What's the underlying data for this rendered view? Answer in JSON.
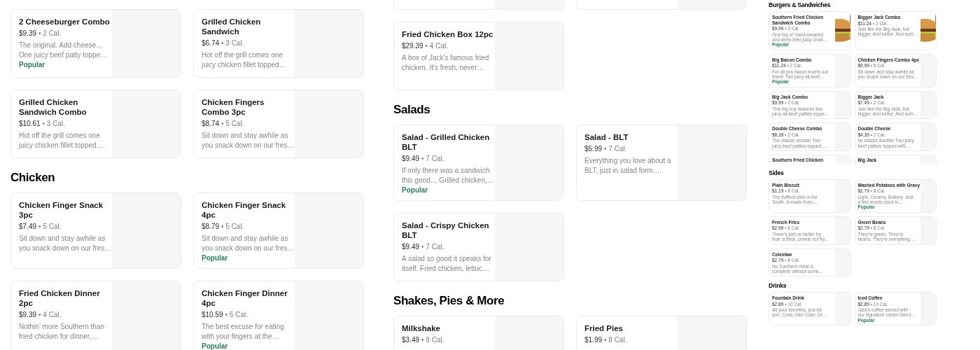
{
  "panels": [
    {
      "sections": [
        {
          "items": [
            {
              "kind": "item",
              "name": "2 Cheeseburger Combo",
              "price": "$9.39",
              "calories": "• 2 Cal.",
              "description": [
                "The original. Add cheese…",
                "One juicy beef patty toppe…"
              ],
              "badge": "Popular"
            },
            {
              "kind": "item",
              "name": "Grilled Chicken Sandwich",
              "price": "$6.74",
              "calories": "• 3 Cal.",
              "description": [
                "Hot off the grill comes one",
                "juicy chicken fillet topped…"
              ]
            },
            {
              "kind": "item",
              "name": "Grilled Chicken Sandwich Combo",
              "price": "$10.61",
              "calories": "• 3 Cal.",
              "description": [
                "Hot off the grill comes one",
                "juicy chicken fillet topped…"
              ]
            },
            {
              "kind": "item",
              "name": "Chicken Fingers Combo 3pc",
              "price": "$8.74",
              "calories": "• 5 Cal.",
              "description": [
                "Sit down and stay awhile as",
                "you snack down on our fres…"
              ]
            }
          ]
        },
        {
          "heading": "Chicken",
          "items": [
            {
              "kind": "item",
              "name": "Chicken Finger Snack 3pc",
              "price": "$7.49",
              "calories": "• 5 Cal.",
              "description": [
                "Sit down and stay awhile as",
                "you snack down on our fres…"
              ]
            },
            {
              "kind": "item",
              "name": "Chicken Finger Snack 4pc",
              "price": "$8.79",
              "calories": "• 5 Cal.",
              "description": [
                "Sit down and stay awhile as",
                "you snack down on our fres…"
              ],
              "badge": "Popular"
            },
            {
              "kind": "item",
              "name": "Fried Chicken Dinner 2pc",
              "price": "$9.39",
              "calories": "• 4 Cal.",
              "description": [
                "Nothin' more Southern than",
                "fried chicken for dinner,…"
              ]
            },
            {
              "kind": "item",
              "name": "Chicken Finger Dinner 4pc",
              "price": "$10.59",
              "calories": "• 5 Cal.",
              "description": [
                "The best excuse for eating",
                "with your fingers at the…"
              ],
              "badge": "Popular"
            }
          ]
        }
      ]
    },
    {
      "sections": [
        {
          "items": [
            {
              "kind": "clipped"
            },
            {
              "kind": "clipped"
            },
            {
              "kind": "item",
              "name": "Fried Chicken Box 12pc",
              "price": "$29.39",
              "calories": "• 4 Cal.",
              "description": [
                "A box of Jack's famous fried",
                "chicken. It's fresh, never…"
              ]
            }
          ]
        },
        {
          "heading": "Salads",
          "items": [
            {
              "kind": "item",
              "name": "Salad - Grilled Chicken BLT",
              "price": "$9.49",
              "calories": "• 7 Cal.",
              "description": [
                "If only there was a sandwich",
                "this good… Grilled chicken,…"
              ],
              "badge": "Popular"
            },
            {
              "kind": "item",
              "name": "Salad - BLT",
              "price": "$5.99",
              "calories": "• 7 Cal.",
              "description": [
                "Everything you love about a",
                "BLT, just in salad form.…"
              ]
            },
            {
              "kind": "item",
              "name": "Salad - Crispy Chicken BLT",
              "price": "$9.49",
              "calories": "• 7 Cal.",
              "description": [
                "A salad so good it speaks for",
                "itself. Fried chicken, lettuc…"
              ]
            }
          ]
        },
        {
          "heading": "Shakes, Pies & More",
          "items": [
            {
              "kind": "item",
              "name": "Milkshake",
              "price": "$3.49",
              "calories": "• 9 Cal."
            },
            {
              "kind": "item",
              "name": "Fried Pies",
              "price": "$1.99",
              "calories": "• 8 Cal."
            }
          ]
        }
      ]
    }
  ],
  "preview": {
    "sections": [
      {
        "heading": "Burgers & Sandwiches",
        "items": [
          {
            "kind": "item",
            "name": "Southern Fried Chicken Sandwich Combo",
            "price": "$9.99",
            "calories": "• 3 Cal.",
            "description": [
              "One big ol' hand-breaded",
              "and deep-fried juicy chick…"
            ],
            "badge": "Popular",
            "image": {
              "kind": "picture"
            }
          },
          {
            "kind": "item",
            "name": "Bigger Jack Combo",
            "price": "$11.24",
            "calories": "• 2 Cal.",
            "description": [
              "Just like the Big Jack, but",
              "bigger. And better. And som…"
            ],
            "image": {
              "kind": "picture"
            }
          },
          {
            "kind": "item",
            "name": "Big Bacon Combo",
            "price": "$11.24",
            "calories": "• 2 Cal.",
            "description": [
              "For all you bacon lovers out",
              "there! Two juicy all-beef…"
            ],
            "badge": "Popular"
          },
          {
            "kind": "item",
            "name": "Chicken Fingers Combo 4pc",
            "price": "$9.99",
            "calories": "• 5 Cal.",
            "description": [
              "Sit down and stay awhile as",
              "you snack down on our fres…"
            ]
          },
          {
            "kind": "item",
            "name": "Big Jack Combo",
            "price": "$9.99",
            "calories": "• 2 Cal.",
            "description": [
              "This big boy features two",
              "juicy all-beef patties toppe…"
            ]
          },
          {
            "kind": "item",
            "name": "Bigger Jack",
            "price": "$7.49",
            "calories": "• 2 Cal.",
            "description": [
              "Just like the Big Jack, but",
              "bigger. And better. And som…"
            ]
          },
          {
            "kind": "item",
            "name": "Double Cheese Combo",
            "price": "$8.39",
            "calories": "• 2 Cal.",
            "description": [
              "The classic double! Two",
              "juicy beef patties topped…"
            ]
          },
          {
            "kind": "item",
            "name": "Double Cheese",
            "price": "$4.39",
            "calories": "• 2 Cal.",
            "description": [
              "he classic double! Two juicy",
              "beef patties topped with…"
            ]
          },
          {
            "kind": "title-only",
            "name": "Southern Fried Chicken"
          },
          {
            "kind": "title-only",
            "name": "Big Jack"
          }
        ]
      },
      {
        "heading": "Sides",
        "items": [
          {
            "kind": "item",
            "name": "Plain Biscuit",
            "price": "$1.19",
            "calories": "• 8 Cal.",
            "description": [
              "The fluffiest side in the",
              "South. A made-from-…"
            ]
          },
          {
            "kind": "item",
            "name": "Mashed Potatoes with Gravy",
            "price": "$2.79",
            "calories": "• 8 Cal.",
            "description": [
              "Light. Creamy. Buttery. Just",
              "a few words used to…"
            ],
            "badge": "Popular"
          },
          {
            "kind": "item",
            "name": "French Fries",
            "price": "$2.99",
            "calories": "• 8 Cal.",
            "description": [
              "There's just no better fry",
              "than a thick, crinkle-cut fry…"
            ]
          },
          {
            "kind": "item",
            "name": "Green Beans",
            "price": "$2.79",
            "calories": "• 8 Cal.",
            "description": [
              "They're green. They're",
              "beans. They're everything…"
            ]
          },
          {
            "kind": "item",
            "name": "Coleslaw",
            "price": "$2.79",
            "calories": "• 8 Cal.",
            "description": [
              "No Southern meal is",
              "complete without some…"
            ]
          }
        ]
      },
      {
        "heading": "Drinks",
        "items": [
          {
            "kind": "item",
            "name": "Fountain Drink",
            "price": "$2.89",
            "calories": "• 10 Cal.",
            "description": [
              "All your favorites, just for",
              "you. Coke, Diet Coke, Dr…"
            ]
          },
          {
            "kind": "item",
            "name": "Iced Coffee",
            "price": "$2.89",
            "calories": "• 10 Cal.",
            "description": [
              "Jack's coffee served with",
              "our signature cream blend…"
            ],
            "badge": "Popular"
          }
        ]
      }
    ]
  }
}
